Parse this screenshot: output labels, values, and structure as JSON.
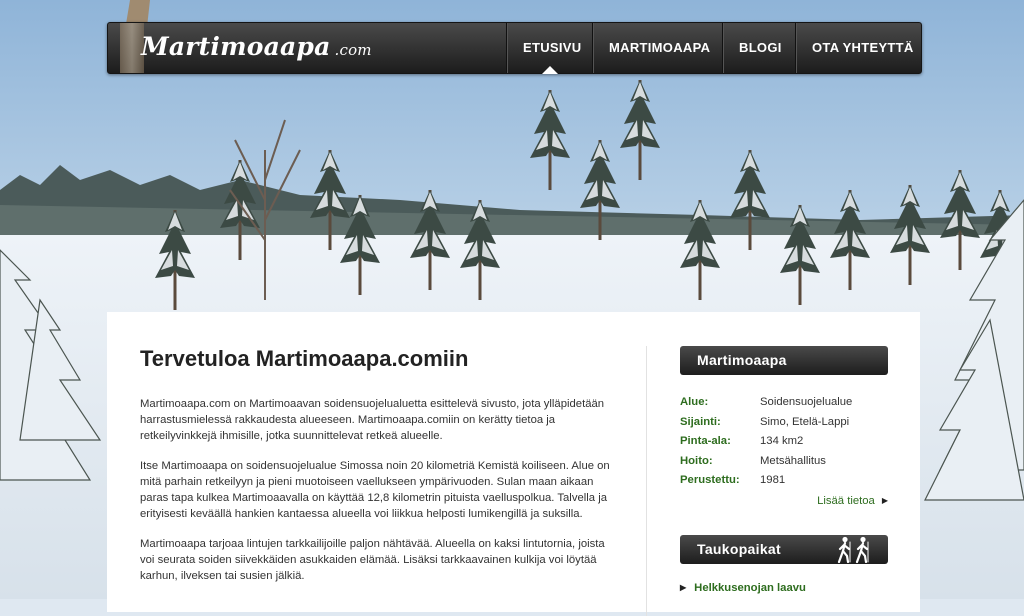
{
  "site": {
    "brand_name": "Martimoaapa",
    "brand_tld": ".com"
  },
  "nav": {
    "items": [
      {
        "label": "ETUSIVU",
        "active": true
      },
      {
        "label": "MARTIMOAAPA",
        "active": false
      },
      {
        "label": "BLOGI",
        "active": false
      },
      {
        "label": "OTA YHTEYTTÄ",
        "active": false
      }
    ]
  },
  "main": {
    "title": "Tervetuloa Martimoaapa.comiin",
    "paragraphs": [
      "Martimoaapa.com on Martimoaavan soidensuojelualuetta esittelevä sivusto, jota ylläpidetään harrastusmielessä rakkaudesta alueeseen. Martimoaapa.comiin on kerätty tietoa ja retkeilyvinkkejä ihmisille, jotka suunnittelevat retkeä alueelle.",
      "Itse Martimoaapa on soidensuojelualue Simossa noin 20 kilometriä Kemistä koiliseen. Alue on mitä parhain retkeilyyn ja pieni muotoiseen vaellukseen ympärivuoden. Sulan maan aikaan paras tapa kulkea Martimoaavalla on käyttää 12,8 kilometrin pituista vaelluspolkua. Talvella ja erityisesti keväällä hankien kantaessa alueella voi liikkua helposti lumikengillä ja suksilla.",
      "Martimoaapa tarjoaa lintujen tarkkailijoille paljon nähtävää. Alueella on kaksi lintutornia, joista voi seurata soiden siivekkäiden asukkaiden elämää. Lisäksi tarkkaavainen kulkija voi löytää karhun, ilveksen tai susien jälkiä."
    ]
  },
  "sidebar": {
    "info_box": {
      "title": "Martimoaapa",
      "rows": [
        {
          "label": "Alue:",
          "value": "Soidensuojelualue"
        },
        {
          "label": "Sijainti:",
          "value": "Simo, Etelä-Lappi"
        },
        {
          "label": "Pinta-ala:",
          "value": "134 km2"
        },
        {
          "label": "Hoito:",
          "value": "Metsähallitus"
        },
        {
          "label": "Perustettu:",
          "value": "1981"
        }
      ],
      "more_link": "Lisää tietoa"
    },
    "rest_box": {
      "title": "Taukopaikat",
      "icon": "hikers-icon",
      "items": [
        "Helkkusenojan laavu"
      ]
    }
  },
  "colors": {
    "accent_green": "#2e6d1f",
    "nav_dark": "#1c1c1c",
    "sky": "#9fc0de"
  }
}
